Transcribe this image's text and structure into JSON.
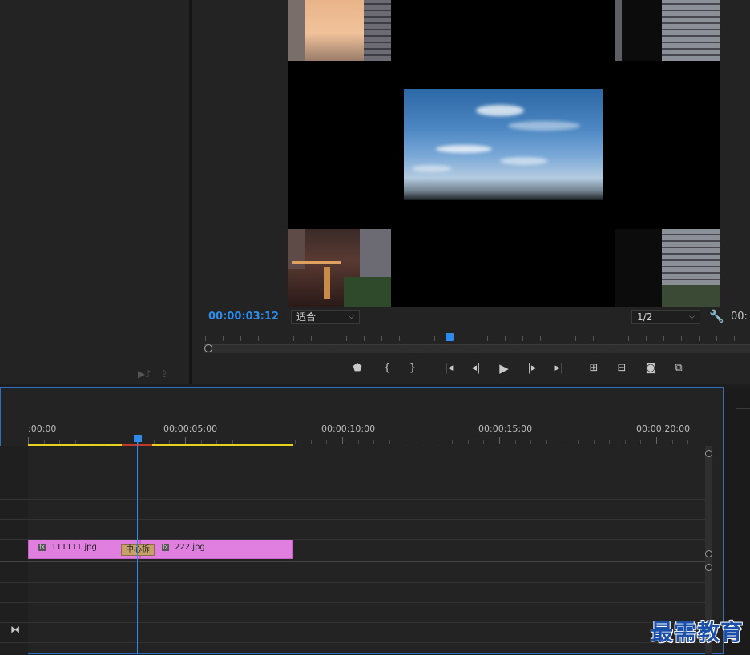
{
  "monitor": {
    "current_time": "00:00:03:12",
    "duration_time": "00:",
    "zoom": "适合",
    "resolution": "1/2"
  },
  "icons": {
    "wrench": "wrench-icon",
    "marker": "marker-icon",
    "mark_in": "mark-in-icon",
    "mark_out": "mark-out-icon",
    "go_to_in": "go-to-in-icon",
    "step_back": "step-back-icon",
    "play": "play-icon",
    "step_forward": "step-forward-icon",
    "go_to_out": "go-to-out-icon",
    "lift": "lift-icon",
    "extract": "extract-icon",
    "export_frame": "camera-icon",
    "comparison": "comparison-icon",
    "insert": "insert-icon",
    "overwrite": "overwrite-icon",
    "snap": "snap-icon"
  },
  "timeline": {
    "ruler_labels": [
      ":00:00",
      "00:00:05:00",
      "00:00:10:00",
      "00:00:15:00",
      "00:00:20:00"
    ],
    "clips": [
      {
        "name": "111111.jpg"
      },
      {
        "name": "222.jpg"
      }
    ],
    "transition_label": "中心拆"
  },
  "watermark": "最需教育",
  "colors": {
    "accent": "#2d8ceb",
    "clip": "#e07fe0",
    "work_area": "#e6d21c"
  }
}
